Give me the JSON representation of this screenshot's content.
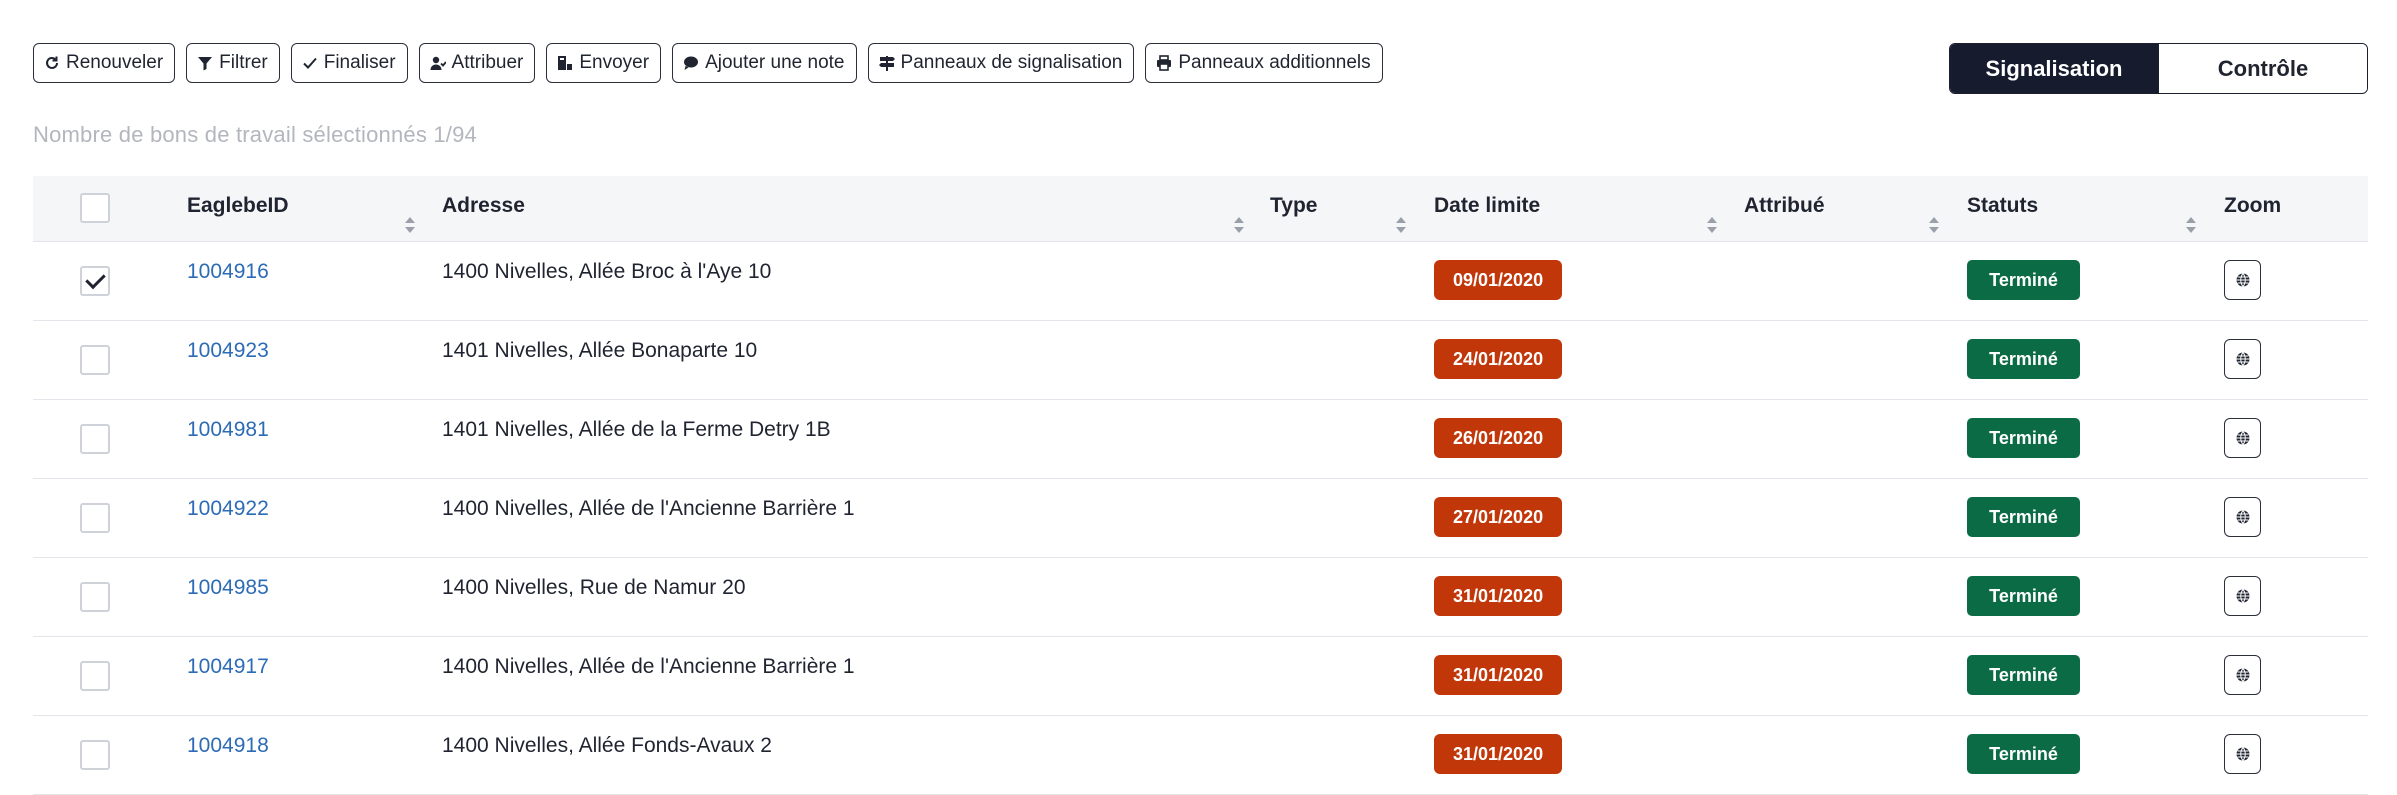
{
  "toolbar": {
    "buttons": [
      {
        "label": "Renouveler",
        "icon": "refresh-icon"
      },
      {
        "label": "Filtrer",
        "icon": "filter-icon"
      },
      {
        "label": "Finaliser",
        "icon": "check-icon"
      },
      {
        "label": "Attribuer",
        "icon": "user-assign-icon"
      },
      {
        "label": "Envoyer",
        "icon": "send-icon"
      },
      {
        "label": "Ajouter une note",
        "icon": "comment-icon"
      },
      {
        "label": "Panneaux de signalisation",
        "icon": "signpost-icon"
      },
      {
        "label": "Panneaux additionnels",
        "icon": "print-icon"
      }
    ]
  },
  "view_toggle": {
    "active": "Signalisation",
    "inactive": "Contrôle",
    "active_color": "#161b2e"
  },
  "selection_count": "Nombre de bons de travail sélectionnés 1/94",
  "table": {
    "headers": {
      "id": "EaglebeID",
      "address": "Adresse",
      "type": "Type",
      "deadline": "Date limite",
      "assigned": "Attribué",
      "status": "Statuts",
      "zoom": "Zoom"
    },
    "rows": [
      {
        "checked": true,
        "id": "1004916",
        "address": "1400 Nivelles, Allée Broc à l'Aye 10",
        "type": "",
        "deadline": "09/01/2020",
        "assigned": "",
        "status": "Terminé"
      },
      {
        "checked": false,
        "id": "1004923",
        "address": "1401 Nivelles, Allée Bonaparte 10",
        "type": "",
        "deadline": "24/01/2020",
        "assigned": "",
        "status": "Terminé"
      },
      {
        "checked": false,
        "id": "1004981",
        "address": "1401 Nivelles, Allée de la Ferme Detry 1B",
        "type": "",
        "deadline": "26/01/2020",
        "assigned": "",
        "status": "Terminé"
      },
      {
        "checked": false,
        "id": "1004922",
        "address": "1400 Nivelles, Allée de l'Ancienne Barrière 1",
        "type": "",
        "deadline": "27/01/2020",
        "assigned": "",
        "status": "Terminé"
      },
      {
        "checked": false,
        "id": "1004985",
        "address": "1400 Nivelles, Rue de Namur 20",
        "type": "",
        "deadline": "31/01/2020",
        "assigned": "",
        "status": "Terminé"
      },
      {
        "checked": false,
        "id": "1004917",
        "address": "1400 Nivelles, Allée de l'Ancienne Barrière 1",
        "type": "",
        "deadline": "31/01/2020",
        "assigned": "",
        "status": "Terminé"
      },
      {
        "checked": false,
        "id": "1004918",
        "address": "1400 Nivelles, Allée Fonds-Avaux 2",
        "type": "",
        "deadline": "31/01/2020",
        "assigned": "",
        "status": "Terminé"
      }
    ]
  },
  "colors": {
    "deadline_badge": "#c2370a",
    "status_badge": "#0b6b45",
    "link": "#2c6bb5"
  }
}
